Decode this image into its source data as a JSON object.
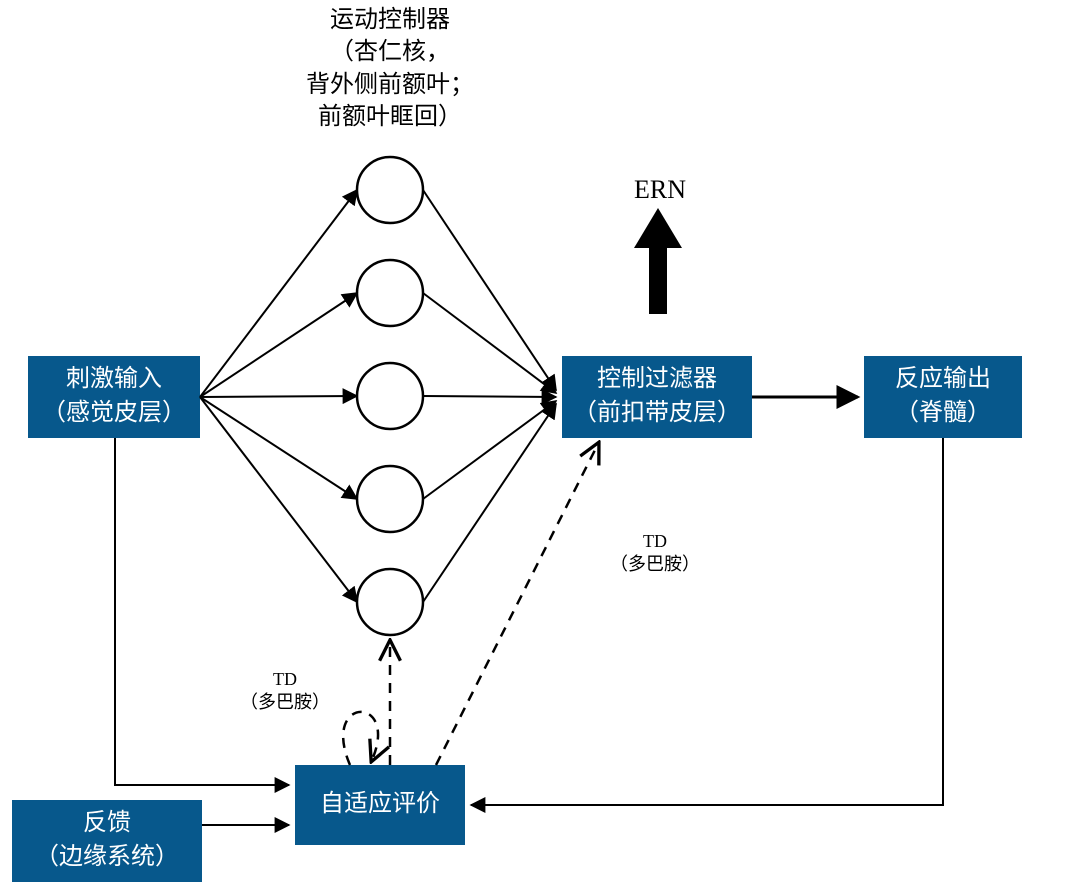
{
  "diagram": {
    "title_lines": [
      "运动控制器",
      "（杏仁核，",
      "背外侧前额叶；",
      "前额叶眶回）"
    ],
    "nodes": {
      "stimulus_input": {
        "line1": "刺激输入",
        "line2": "（感觉皮层）"
      },
      "control_filter": {
        "line1": "控制过滤器",
        "line2": "（前扣带皮层）"
      },
      "response_output": {
        "line1": "反应输出",
        "line2": "（脊髓）"
      },
      "adaptive_critic": {
        "line1": "自适应评价"
      },
      "feedback": {
        "line1": "反馈",
        "line2": "（边缘系统）"
      }
    },
    "labels": {
      "ern": "ERN",
      "td1": {
        "line1": "TD",
        "line2": "（多巴胺）"
      },
      "td2": {
        "line1": "TD",
        "line2": "（多巴胺）"
      }
    },
    "edges": [
      {
        "from": "stimulus_input",
        "to": "motor_controllers",
        "type": "solid_arrow"
      },
      {
        "from": "motor_controllers",
        "to": "control_filter",
        "type": "solid_arrow"
      },
      {
        "from": "control_filter",
        "to": "response_output",
        "type": "solid_arrow"
      },
      {
        "from": "control_filter",
        "to": "ERN",
        "type": "thick_arrow"
      },
      {
        "from": "stimulus_input",
        "to": "adaptive_critic",
        "type": "solid_arrow"
      },
      {
        "from": "feedback",
        "to": "adaptive_critic",
        "type": "solid_arrow"
      },
      {
        "from": "response_output",
        "to": "adaptive_critic",
        "type": "solid_arrow"
      },
      {
        "from": "adaptive_critic",
        "to": "control_filter",
        "type": "dashed_arrow",
        "label": "TD（多巴胺）"
      },
      {
        "from": "adaptive_critic",
        "to": "motor_controllers",
        "type": "dashed_arrow",
        "label": "TD（多巴胺）"
      },
      {
        "from": "adaptive_critic",
        "to": "adaptive_critic",
        "type": "dashed_self_loop"
      }
    ],
    "motor_controller_nodes": 5,
    "colors": {
      "box_fill": "#07588c",
      "box_text": "#ffffff",
      "stroke": "#000000"
    }
  }
}
